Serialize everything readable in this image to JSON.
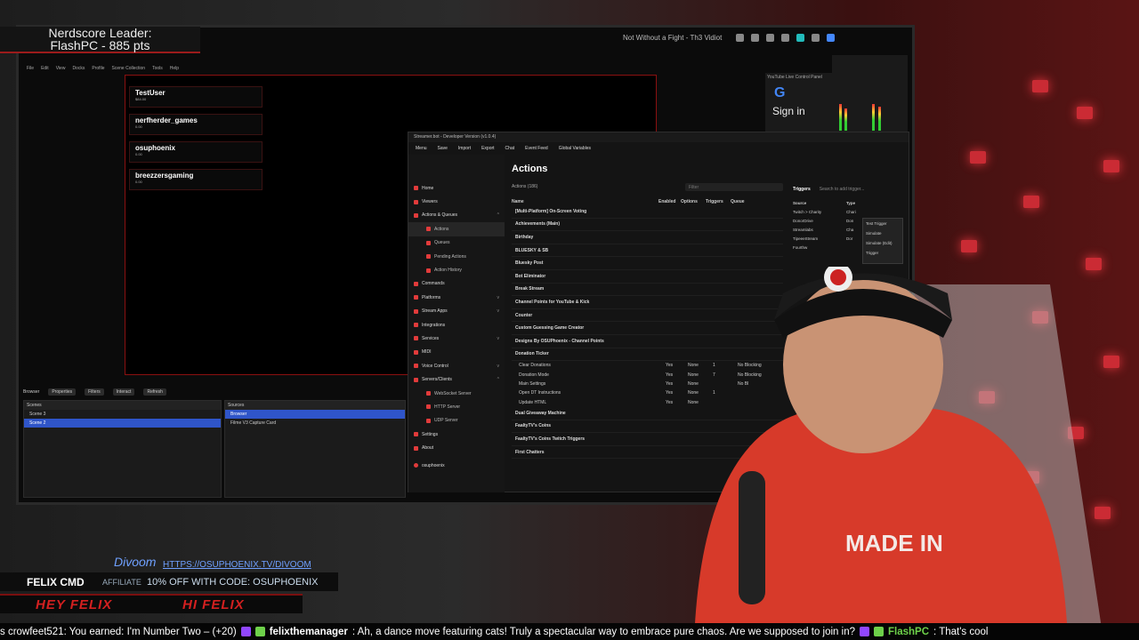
{
  "leader": {
    "line1": "Nerdscore Leader:",
    "line2": "FlashPC - 885 pts"
  },
  "taskbar": {
    "now_playing": "Not Without a Fight - Th3 Vidiot"
  },
  "obs": {
    "menu": [
      "File",
      "Edit",
      "View",
      "Docks",
      "Profile",
      "Scene Collection",
      "Tools",
      "Help"
    ],
    "leaderboard": [
      {
        "name": "TestUser",
        "pts": "$84.00"
      },
      {
        "name": "nerfherder_games",
        "pts": "0.00"
      },
      {
        "name": "osuphoenix",
        "pts": "0.00"
      },
      {
        "name": "breezzersgaming",
        "pts": "0.00"
      }
    ],
    "controls": [
      "Browser",
      "Properties",
      "Filters",
      "Interact",
      "Refresh"
    ],
    "scenes_title": "Scenes",
    "scenes": [
      "Scene 3",
      "Scene 2"
    ],
    "sources_title": "Sources",
    "sources": [
      "Browser",
      "Filme V3 Capture Card"
    ]
  },
  "youtube": {
    "header": "YouTube Live Control Panel",
    "g": "G",
    "signin": "Sign in"
  },
  "streamerbot": {
    "title": "Streamer.bot - Developer Version (v1.0.4)",
    "toolbar": [
      "Menu",
      "Save",
      "Import",
      "Export",
      "Chat",
      "Event Feed",
      "Global Variables"
    ],
    "nav": [
      {
        "label": "Home",
        "sub": false
      },
      {
        "label": "Viewers",
        "sub": false
      },
      {
        "label": "Actions & Queues",
        "sub": false,
        "chev": "^"
      },
      {
        "label": "Actions",
        "sub": true,
        "active": true
      },
      {
        "label": "Queues",
        "sub": true
      },
      {
        "label": "Pending Actions",
        "sub": true
      },
      {
        "label": "Action History",
        "sub": true
      },
      {
        "label": "Commands",
        "sub": false
      },
      {
        "label": "Platforms",
        "sub": false,
        "chev": "v"
      },
      {
        "label": "Stream Apps",
        "sub": false,
        "chev": "v"
      },
      {
        "label": "Integrations",
        "sub": false
      },
      {
        "label": "Services",
        "sub": false,
        "chev": "v"
      },
      {
        "label": "MIDI",
        "sub": false
      },
      {
        "label": "Voice Control",
        "sub": false,
        "chev": "v"
      },
      {
        "label": "Servers/Clients",
        "sub": false,
        "chev": "^"
      },
      {
        "label": "WebSocket Server",
        "sub": true
      },
      {
        "label": "HTTP Server",
        "sub": true
      },
      {
        "label": "UDP Server",
        "sub": true
      },
      {
        "label": "Settings",
        "sub": false
      },
      {
        "label": "About",
        "sub": false
      }
    ],
    "user": "osuphoenix",
    "actions_title": "Actions",
    "actions_count": "Actions (186)",
    "filter_placeholder": "Filter",
    "cols": [
      "Name",
      "Enabled",
      "Options",
      "Triggers",
      "Queue"
    ],
    "groups_top": [
      "[Multi-Platform] On-Screen Voting",
      "Achievements (Main)",
      "Birthday",
      "BLUESKY & SB",
      "Bluesky Post",
      "Bot Eliminator",
      "Break Stream",
      "Channel Points for YouTube & Kick",
      "Counter",
      "Custom Guessing Game Creator",
      "Designs By OSUPhoenix - Channel Points",
      "Donation Ticker"
    ],
    "donation_rows": [
      {
        "name": "Clear Donations",
        "enabled": "Yes",
        "opt": "None",
        "trig": "1",
        "queue": "No Blocking"
      },
      {
        "name": "Donation Mode",
        "enabled": "Yes",
        "opt": "None",
        "trig": "7",
        "queue": "No Blocking"
      },
      {
        "name": "Main Settings",
        "enabled": "Yes",
        "opt": "None",
        "trig": "",
        "queue": "No Bl"
      },
      {
        "name": "Open DT Instructions",
        "enabled": "Yes",
        "opt": "None",
        "trig": "1",
        "queue": ""
      },
      {
        "name": "Update HTML",
        "enabled": "Yes",
        "opt": "None",
        "trig": "",
        "queue": ""
      }
    ],
    "groups_bottom": [
      "Dual Giveaway Machine",
      "FaaltyTV's Coins",
      "FaaltyTV's Coins Twitch Triggers",
      "First Chatters"
    ],
    "triggers_title": "Triggers",
    "triggers_search": "Search to add trigger...",
    "trigger_cols": [
      "Source",
      "Type"
    ],
    "triggers": [
      {
        "source": "Twitch > Charity",
        "type": "Chari"
      },
      {
        "source": "DonorDrive",
        "type": "Don"
      },
      {
        "source": "Streamlabs",
        "type": "Cha"
      },
      {
        "source": "TipeeeStream",
        "type": "Dor"
      },
      {
        "source": "Fourthw",
        "type": ""
      }
    ],
    "context_menu": [
      "Test Trigger",
      "Simulate",
      "Simulate (Edit)",
      "Trigger"
    ]
  },
  "overlay": {
    "divoom": "Divoom",
    "divoom_url": "HTTPS://OSUPHOENIX.TV/DIVOOM",
    "felix_cmd": "FELIX CMD",
    "affiliate": "AFFILIATE",
    "code": "10% OFF WITH CODE: OSUPHOENIX",
    "hey": "HEY FELIX",
    "hi": "HI FELIX"
  },
  "ticker": {
    "msg1": "s crowfeet521: You earned: I'm Number Two – (+20)",
    "user2": "felixthemanager",
    "msg2": ": Ah, a dance move featuring cats! Truly a spectacular way to embrace pure chaos. Are we supposed to join in?",
    "user3": "FlashPC",
    "msg3": ": That's cool"
  },
  "colors": {
    "accent_red": "#e23b3b",
    "selection_blue": "#2f55c9",
    "ticker_green": "#6ed14a"
  }
}
